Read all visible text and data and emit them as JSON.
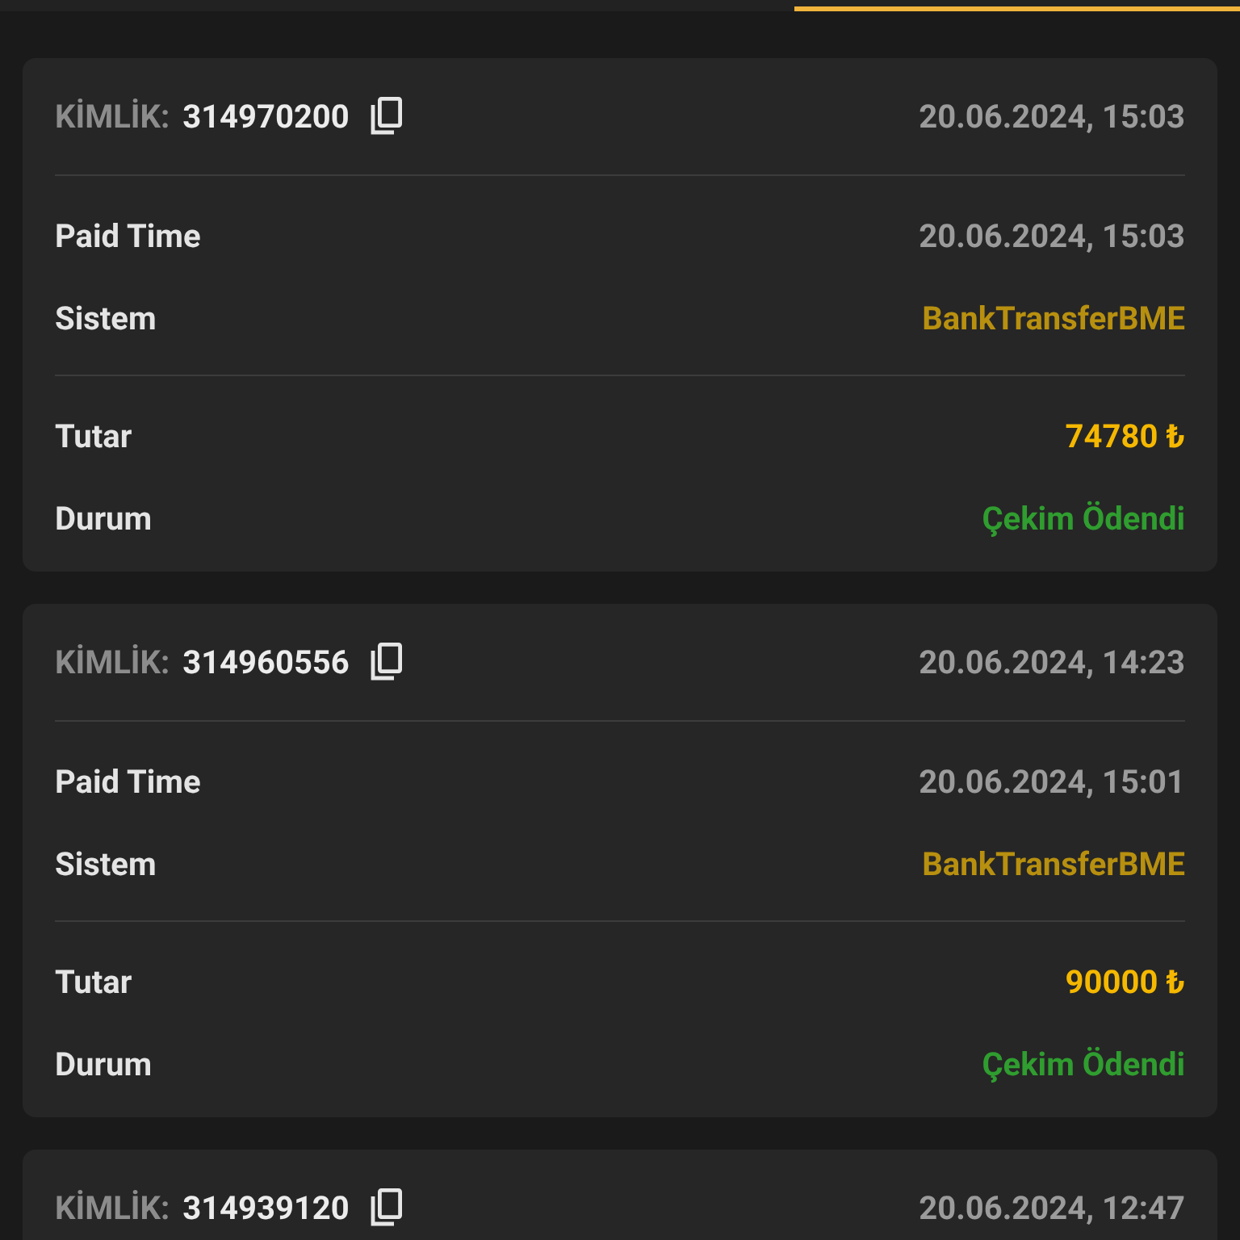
{
  "records": [
    {
      "id_label": "KİMLİK:",
      "id": "314970200",
      "date": "20.06.2024, 15:03",
      "sections": [
        [
          {
            "label": "Paid Time",
            "value": "20.06.2024, 15:03",
            "kind": "date"
          },
          {
            "label": "Sistem",
            "value": "BankTransferBME",
            "kind": "system"
          }
        ],
        [
          {
            "label": "Tutar",
            "value": "74780 ₺",
            "kind": "amount"
          },
          {
            "label": "Durum",
            "value": "Çekim Ödendi",
            "kind": "status"
          }
        ]
      ]
    },
    {
      "id_label": "KİMLİK:",
      "id": "314960556",
      "date": "20.06.2024, 14:23",
      "sections": [
        [
          {
            "label": "Paid Time",
            "value": "20.06.2024, 15:01",
            "kind": "date"
          },
          {
            "label": "Sistem",
            "value": "BankTransferBME",
            "kind": "system"
          }
        ],
        [
          {
            "label": "Tutar",
            "value": "90000 ₺",
            "kind": "amount"
          },
          {
            "label": "Durum",
            "value": "Çekim Ödendi",
            "kind": "status"
          }
        ]
      ]
    },
    {
      "id_label": "KİMLİK:",
      "id": "314939120",
      "date": "20.06.2024, 12:47"
    }
  ]
}
